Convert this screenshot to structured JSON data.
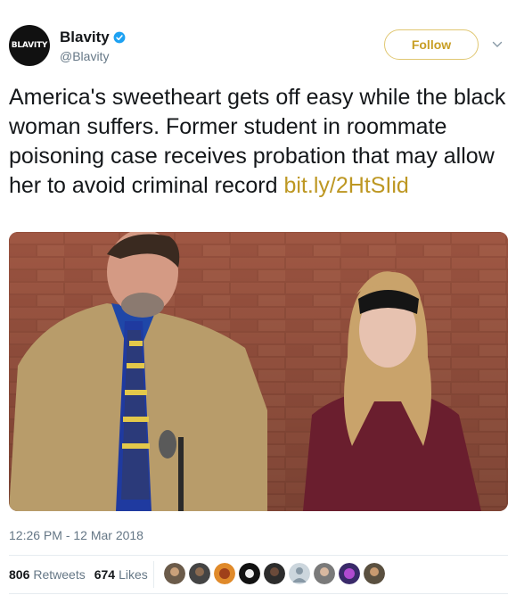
{
  "user": {
    "avatar_text": "BLAVITY",
    "display_name": "Blavity",
    "handle": "@Blavity",
    "verified_icon": "verified-badge-icon"
  },
  "actions": {
    "follow_label": "Follow",
    "more_icon": "chevron-down-icon"
  },
  "tweet": {
    "text": "America's sweetheart gets off easy while the black woman suffers. Former student in roommate poisoning case receives probation that may allow her to avoid criminal record",
    "link": "bit.ly/2HtSIid",
    "timestamp": "12:26 PM - 12 Mar 2018"
  },
  "stats": {
    "retweets_count": "806",
    "retweets_label": "Retweets",
    "likes_count": "674",
    "likes_label": "Likes"
  },
  "colors": {
    "accent": "#c89e24",
    "link": "#bd9722",
    "muted": "#657786",
    "verified": "#1da1f2"
  }
}
